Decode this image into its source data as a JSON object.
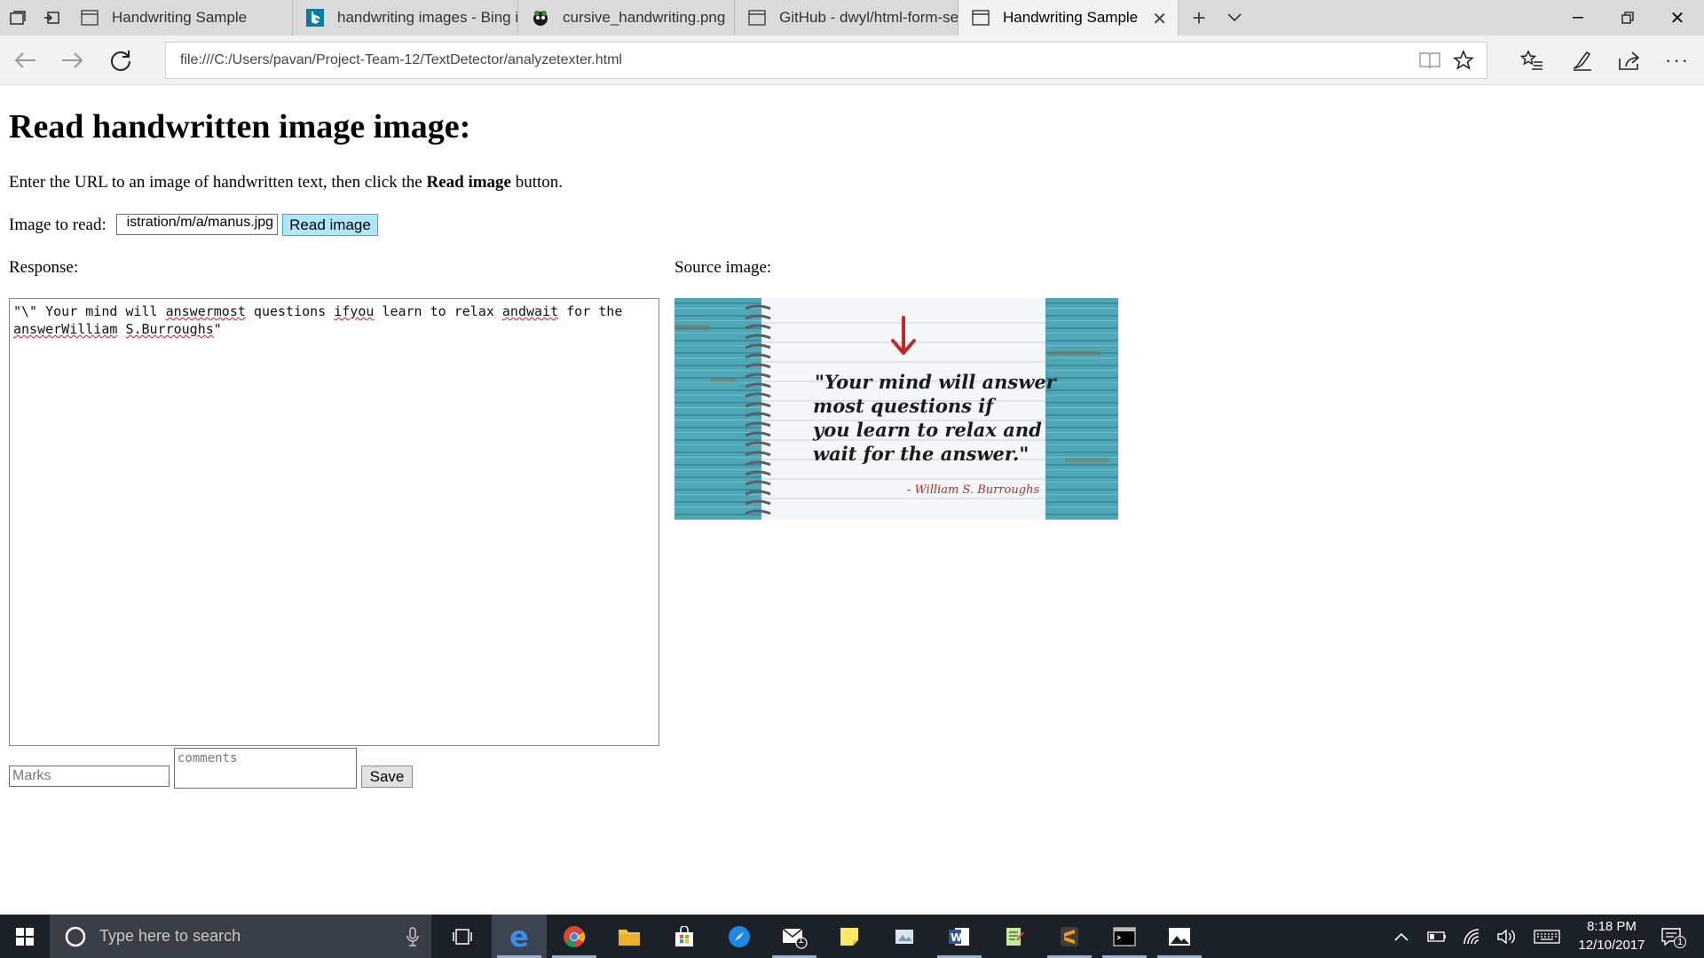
{
  "browser": {
    "tabs": [
      {
        "label": "Handwriting Sample",
        "icon": "page-icon",
        "active": false
      },
      {
        "label": "handwriting images - Bing i",
        "icon": "bing-icon",
        "active": false
      },
      {
        "label": "cursive_handwriting.png",
        "icon": "image-icon",
        "active": false
      },
      {
        "label": "GitHub - dwyl/html-form-se",
        "icon": "page-icon",
        "active": false
      },
      {
        "label": "Handwriting Sample",
        "icon": "page-icon",
        "active": true
      }
    ],
    "url": "file:///C:/Users/pavan/Project-Team-12/TextDetector/analyzetexter.html"
  },
  "page": {
    "heading": "Read handwritten image image:",
    "instructions_prefix": "Enter the URL to an image of handwritten text, then click the ",
    "instructions_bold": "Read image",
    "instructions_suffix": " button.",
    "image_label": "Image to read:",
    "url_input_value": "istration/m/a/manus.jpg",
    "read_button_label": "Read image",
    "response_label": "Response:",
    "source_label": "Source image:",
    "response_text": {
      "t1": "\"\\\" Your mind will ",
      "t2": "answermost",
      "t3": " questions ",
      "t4": "ifyou",
      "t5": " learn to relax ",
      "t6": "andwait",
      "t7": " for the ",
      "t8": "answerWilliam",
      "t9": " ",
      "t10": "S.Burroughs",
      "t11": "\""
    },
    "source_image": {
      "quote_line1": "\"Your mind will answer",
      "quote_line2": "most questions if",
      "quote_line3": "you learn to relax and",
      "quote_line4": "wait for the answer.\"",
      "attribution": "- William S. Burroughs"
    },
    "marks_placeholder": "Marks",
    "comments_placeholder": "comments",
    "save_button_label": "Save"
  },
  "taskbar": {
    "search_placeholder": "Type here to search",
    "time": "8:18 PM",
    "date": "12/10/2017",
    "mail_badge": "1",
    "notification_badge": "1"
  },
  "colors": {
    "read_button_bg": "#aee8f8",
    "taskbar_bg": "#1c2128",
    "active_tab_bg": "#f2f2f2",
    "tabbar_bg": "#dadada"
  }
}
